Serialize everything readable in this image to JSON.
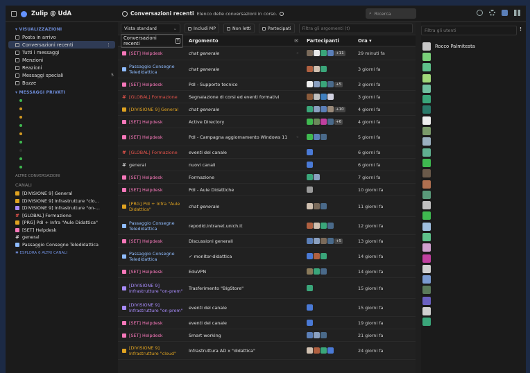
{
  "topbar": {
    "brand": "Zulip @ UdA",
    "view_title": "Conversazioni recenti",
    "view_subtitle": "Elenco delle conversazioni in corso.",
    "search_placeholder": "Ricerca"
  },
  "left": {
    "views_header": "▾ VISUALIZZAZIONI",
    "views": [
      {
        "label": "Posta in arrivo",
        "count": ""
      },
      {
        "label": "Conversazioni recenti",
        "count": "",
        "active": true
      },
      {
        "label": "Tutti i messaggi",
        "count": ""
      },
      {
        "label": "Menzioni",
        "count": ""
      },
      {
        "label": "Reazioni",
        "count": ""
      },
      {
        "label": "Messaggi speciali",
        "count": "5"
      },
      {
        "label": "Bozze",
        "count": ""
      }
    ],
    "dm_header": "▾ MESSAGGI PRIVATI",
    "dm_dots": [
      "#3fb950",
      "#d29922",
      "#d29922",
      "#3fb950",
      "#d29922",
      "#3fb950",
      "#2d2d2d",
      "#3fb950",
      "#3fb950"
    ],
    "other_conv": "ALTRE CONVERSAZIONI",
    "channels_header": "CANALI",
    "channels": [
      {
        "label": "[DIVISIONE 9] General",
        "kind": "lock",
        "color": "#e0a321"
      },
      {
        "label": "[DIVISIONE 9] Infrastrutture \"clo...",
        "kind": "lock",
        "color": "#e0a321"
      },
      {
        "label": "[DIVISIONE 9] Infrastrutture \"on-...",
        "kind": "lock",
        "color": "#a78bfa"
      },
      {
        "label": "[GLOBAL] Formazione",
        "kind": "hash",
        "color": "#e5534b"
      },
      {
        "label": "[PRG] PdI + Infra \"Aule Didattica\"",
        "kind": "lock",
        "color": "#e0a321"
      },
      {
        "label": "[SET] Helpdesk",
        "kind": "lock",
        "color": "#f778ba"
      },
      {
        "label": "general",
        "kind": "hash",
        "color": "#d7d7d7"
      },
      {
        "label": "Passaggio Consegne Teledidattica",
        "kind": "lock",
        "color": "#8fbcff"
      }
    ],
    "browse": "✱ ESPLORA 6 ALTRI CANALI"
  },
  "filters": {
    "view": "Vista standard",
    "include_dm": "Includi MP",
    "unread": "Non letti",
    "participated": "Partecipati",
    "filter_placeholder": "Filtra gli argomenti (t)"
  },
  "table": {
    "col_conv": "Conversazioni recenti",
    "col_conv_kbd": "T",
    "col_topic": "Argomento",
    "col_part": "Partecipanti",
    "col_time": "Ora ▾",
    "rows": [
      {
        "channel": "[SET] Helpdesk",
        "kind": "lock",
        "color": "#f778ba",
        "topic": "chat generale",
        "italic": true,
        "muted": true,
        "avatars": [
          "#7a6a5a",
          "#e9e9e9",
          "#3aa67a",
          "#5b7fb8"
        ],
        "more": "+11",
        "time": "29 minuti fa",
        "h": 20
      },
      {
        "channel": "Passaggio Consegne Teledidattica",
        "kind": "lock",
        "color": "#8fbcff",
        "topic": "chat generale",
        "italic": true,
        "avatars": [
          "#b06040",
          "#d0c0b0",
          "#3aa67a"
        ],
        "more": "",
        "time": "3 giorni fa",
        "h": 26
      },
      {
        "channel": "[SET] Helpdesk",
        "kind": "lock",
        "color": "#f778ba",
        "topic": "PdI - Supporto tecnico",
        "italic": false,
        "avatars": [
          "#eeeeee",
          "#8aa0c0",
          "#3aa67a",
          "#4a6a8a"
        ],
        "more": "+5",
        "time": "3 giorni fa",
        "h": 18
      },
      {
        "channel": "[GLOBAL] Formazione",
        "kind": "hash",
        "color": "#e5534b",
        "topic": "Segnalazione di corsi ed eventi formativi",
        "italic": false,
        "avatars": [
          "#8a5a3a",
          "#c0c0c0",
          "#4080c0",
          "#d0d0e0"
        ],
        "more": "",
        "time": "3 giorni fa",
        "h": 18
      },
      {
        "channel": "[DIVISIONE 9] General",
        "kind": "lock",
        "color": "#e0a321",
        "topic": "chat generale",
        "italic": true,
        "avatars": [
          "#3aa67a",
          "#8aa0c0",
          "#5b7fb8",
          "#9a8a7a"
        ],
        "more": "+10",
        "time": "4 giorni fa",
        "h": 18
      },
      {
        "channel": "[SET] Helpdesk",
        "kind": "lock",
        "color": "#f778ba",
        "topic": "Active Directory",
        "italic": false,
        "avatars": [
          "#3fb950",
          "#6a8a5a",
          "#c040a0",
          "#4a6a8a"
        ],
        "more": "+6",
        "time": "4 giorni fa",
        "h": 18
      },
      {
        "channel": "[SET] Helpdesk",
        "kind": "lock",
        "color": "#f778ba",
        "topic": "PdI - Campagna aggiornamento Windows 11",
        "italic": false,
        "muted": true,
        "avatars": [
          "#3fb950",
          "#5b7fb8",
          "#4a6a8a"
        ],
        "more": "",
        "time": "5 giorni fa",
        "h": 26
      },
      {
        "channel": "[GLOBAL] Formazione",
        "kind": "hash",
        "color": "#e5534b",
        "topic": "eventi del canale",
        "italic": false,
        "avatars": [
          "#4a7ad6"
        ],
        "more": "",
        "time": "6 giorni fa",
        "h": 18
      },
      {
        "channel": "general",
        "kind": "hash",
        "color": "#d7d7d7",
        "topic": "nuovi canali",
        "italic": false,
        "avatars": [
          "#4a7ad6"
        ],
        "more": "",
        "time": "6 giorni fa",
        "h": 18
      },
      {
        "channel": "[SET] Helpdesk",
        "kind": "lock",
        "color": "#f778ba",
        "topic": "Formazione",
        "italic": false,
        "avatars": [
          "#3aa67a",
          "#8aa0c0"
        ],
        "more": "",
        "time": "7 giorni fa",
        "h": 18
      },
      {
        "channel": "[SET] Helpdesk",
        "kind": "lock",
        "color": "#f778ba",
        "topic": "PdI - Aule Didattiche",
        "italic": false,
        "avatars": [
          "#9a9a9a"
        ],
        "more": "",
        "time": "10 giorni fa",
        "h": 18
      },
      {
        "channel": "[PRG] PdI + Infra \"Aule Didattica\"",
        "kind": "lock",
        "color": "#e0a321",
        "topic": "chat generale",
        "italic": true,
        "avatars": [
          "#d0c0b0",
          "#7a6a5a",
          "#4a6a8a"
        ],
        "more": "",
        "time": "11 giorni fa",
        "h": 30
      },
      {
        "channel": "Passaggio Consegne Teledidattica",
        "kind": "lock",
        "color": "#8fbcff",
        "topic": "repodid.intranet.unich.it",
        "italic": false,
        "avatars": [
          "#b06040",
          "#d0c0b0",
          "#3aa67a",
          "#4a6a8a"
        ],
        "more": "",
        "time": "12 giorni fa",
        "h": 26
      },
      {
        "channel": "[SET] Helpdesk",
        "kind": "lock",
        "color": "#f778ba",
        "topic": "Discussioni generali",
        "italic": false,
        "avatars": [
          "#5b7fb8",
          "#8aa0c0",
          "#7a6a5a",
          "#4a6a8a"
        ],
        "more": "+5",
        "time": "13 giorni fa",
        "h": 18
      },
      {
        "channel": "Passaggio Consegne Teledidattica",
        "kind": "lock",
        "color": "#8fbcff",
        "topic": "✓ monitor-didattica",
        "italic": false,
        "avatars": [
          "#4a7ad6",
          "#b06040",
          "#3aa67a"
        ],
        "more": "",
        "time": "14 giorni fa",
        "h": 26
      },
      {
        "channel": "[SET] Helpdesk",
        "kind": "lock",
        "color": "#f778ba",
        "topic": "EduVPN",
        "italic": false,
        "avatars": [
          "#8a7a5a",
          "#3aa67a",
          "#4a6a8a"
        ],
        "more": "",
        "time": "14 giorni fa",
        "h": 18
      },
      {
        "channel": "[DIVISIONE 9] Infrastrutture \"on-prem\"",
        "kind": "lock",
        "color": "#a78bfa",
        "topic": "Trasferimento \"BigStore\"",
        "italic": false,
        "avatars": [
          "#3aa67a"
        ],
        "more": "",
        "time": "15 giorni fa",
        "h": 30
      },
      {
        "channel": "[DIVISIONE 9] Infrastrutture \"on-prem\"",
        "kind": "lock",
        "color": "#a78bfa",
        "topic": "eventi del canale",
        "italic": false,
        "avatars": [
          "#4a7ad6"
        ],
        "more": "",
        "time": "15 giorni fa",
        "h": 26
      },
      {
        "channel": "[SET] Helpdesk",
        "kind": "lock",
        "color": "#f778ba",
        "topic": "eventi del canale",
        "italic": false,
        "avatars": [
          "#4a7ad6"
        ],
        "more": "",
        "time": "19 giorni fa",
        "h": 18
      },
      {
        "channel": "[SET] Helpdesk",
        "kind": "lock",
        "color": "#f778ba",
        "topic": "Smart working",
        "italic": false,
        "avatars": [
          "#5b7fb8",
          "#8aa0c0",
          "#4a6a8a"
        ],
        "more": "",
        "time": "21 giorni fa",
        "h": 18
      },
      {
        "channel": "[DIVISIONE 9] Infrastrutture \"cloud\"",
        "kind": "lock",
        "color": "#e0a321",
        "topic": "Infrastruttura AD x \"didattica\"",
        "italic": false,
        "avatars": [
          "#d0c0b0",
          "#b06040",
          "#3aa67a",
          "#4a7ad6"
        ],
        "more": "",
        "time": "24 giorni fa",
        "h": 26
      }
    ]
  },
  "right": {
    "filter_placeholder": "Filtra gli utenti",
    "users": [
      {
        "name": "Rocco Palmitesta",
        "color": "#c9c9c9"
      },
      {
        "name": "",
        "color": "#7ad07a"
      },
      {
        "name": "",
        "color": "#5ec08a"
      },
      {
        "name": "",
        "color": "#a0d87a"
      },
      {
        "name": "",
        "color": "#70c0a0"
      },
      {
        "name": "",
        "color": "#3aa67a"
      },
      {
        "name": "",
        "color": "#2a7a6a"
      },
      {
        "name": "",
        "color": "#eeeeee"
      },
      {
        "name": "",
        "color": "#7a9a6a"
      },
      {
        "name": "",
        "color": "#9ab0c0"
      },
      {
        "name": "",
        "color": "#60b090"
      },
      {
        "name": "",
        "color": "#3fb950"
      },
      {
        "name": "",
        "color": "#6a5a4a"
      },
      {
        "name": "",
        "color": "#b07050"
      },
      {
        "name": "",
        "color": "#5a9a7a"
      },
      {
        "name": "",
        "color": "#c0c0c0"
      },
      {
        "name": "",
        "color": "#3fb950"
      },
      {
        "name": "",
        "color": "#a0c0e0"
      },
      {
        "name": "",
        "color": "#5ec08a"
      },
      {
        "name": "",
        "color": "#d0a0d0"
      },
      {
        "name": "",
        "color": "#c040a0"
      },
      {
        "name": "",
        "color": "#d0d0d0"
      },
      {
        "name": "",
        "color": "#7a9ad0"
      },
      {
        "name": "",
        "color": "#5a7a5a"
      },
      {
        "name": "",
        "color": "#6a60c0"
      },
      {
        "name": "",
        "color": "#d0d0d0"
      },
      {
        "name": "",
        "color": "#3aa67a"
      }
    ]
  }
}
